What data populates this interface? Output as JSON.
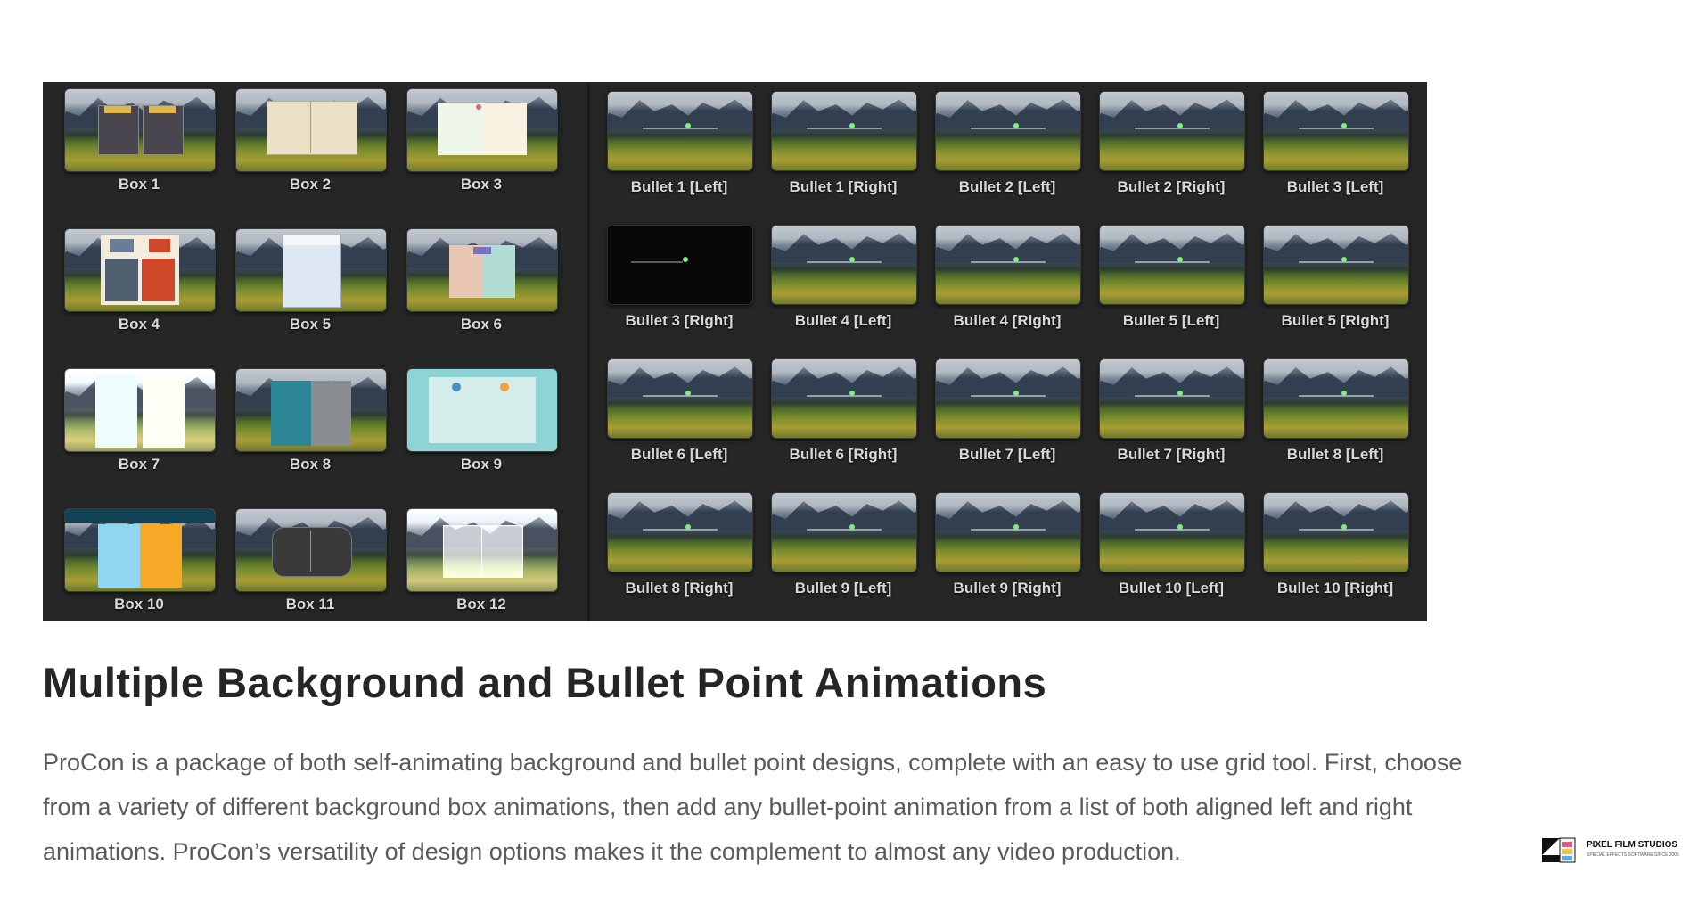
{
  "box_tiles": [
    {
      "label": "Box 1"
    },
    {
      "label": "Box 2"
    },
    {
      "label": "Box 3"
    },
    {
      "label": "Box 4"
    },
    {
      "label": "Box 5"
    },
    {
      "label": "Box 6"
    },
    {
      "label": "Box 7"
    },
    {
      "label": "Box 8"
    },
    {
      "label": "Box 9"
    },
    {
      "label": "Box 10"
    },
    {
      "label": "Box 11"
    },
    {
      "label": "Box 12"
    }
  ],
  "bullet_tiles": [
    {
      "label": "Bullet 1 [Left]"
    },
    {
      "label": "Bullet 1 [Right]"
    },
    {
      "label": "Bullet 2 [Left]"
    },
    {
      "label": "Bullet 2 [Right]"
    },
    {
      "label": "Bullet 3 [Left]"
    },
    {
      "label": "Bullet 3 [Right]"
    },
    {
      "label": "Bullet 4 [Left]"
    },
    {
      "label": "Bullet 4 [Right]"
    },
    {
      "label": "Bullet 5 [Left]"
    },
    {
      "label": "Bullet 5 [Right]"
    },
    {
      "label": "Bullet 6 [Left]"
    },
    {
      "label": "Bullet 6 [Right]"
    },
    {
      "label": "Bullet 7 [Left]"
    },
    {
      "label": "Bullet 7 [Right]"
    },
    {
      "label": "Bullet 8 [Left]"
    },
    {
      "label": "Bullet 8 [Right]"
    },
    {
      "label": "Bullet 9 [Left]"
    },
    {
      "label": "Bullet 9 [Right]"
    },
    {
      "label": "Bullet 10 [Left]"
    },
    {
      "label": "Bullet 10 [Right]"
    }
  ],
  "headline": "Multiple Background and Bullet Point Animations",
  "description": "ProCon is a package of both self-animating background and bullet point designs, complete with an easy to use grid tool. First, choose from a variety of different background box animations, then add any bullet-point animation from a list of both aligned left and right animations. ProCon’s versatility of design options makes it the complement to almost any video production.",
  "brand": {
    "name": "PIXEL FILM STUDIOS",
    "tagline": "SPECIAL EFFECTS SOFTWARE SINCE 2005",
    "icon": "film-strip-logo"
  },
  "colors": {
    "preview_bg": "#262626",
    "headline": "#252525",
    "body_text": "#5a5a5a",
    "label_text": "#d8d8d8",
    "bullet_dot": "#7cf07a"
  }
}
